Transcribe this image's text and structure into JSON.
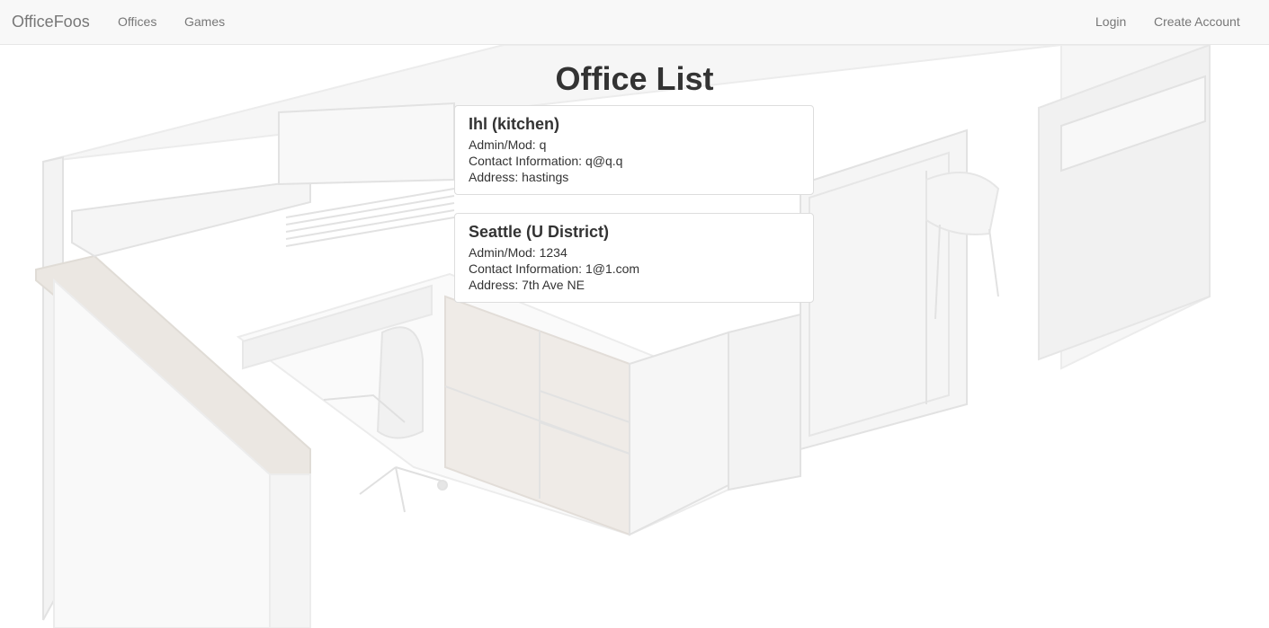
{
  "navbar": {
    "brand": "OfficeFoos",
    "left_links": [
      "Offices",
      "Games"
    ],
    "right_links": [
      "Login",
      "Create Account"
    ]
  },
  "main": {
    "title": "Office List",
    "offices": [
      {
        "name": "Ihl (kitchen)",
        "admin_label": "Admin/Mod:",
        "admin": "q",
        "contact_label": "Contact Information:",
        "contact": "q@q.q",
        "address_label": "Address:",
        "address": "hastings"
      },
      {
        "name": "Seattle (U District)",
        "admin_label": "Admin/Mod:",
        "admin": "1234",
        "contact_label": "Contact Information:",
        "contact": "1@1.com",
        "address_label": "Address:",
        "address": "7th Ave NE"
      }
    ]
  },
  "colors": {
    "navbar_bg": "#f8f8f8",
    "nav_text": "#777777",
    "text": "#333333",
    "card_border": "#dddddd"
  }
}
